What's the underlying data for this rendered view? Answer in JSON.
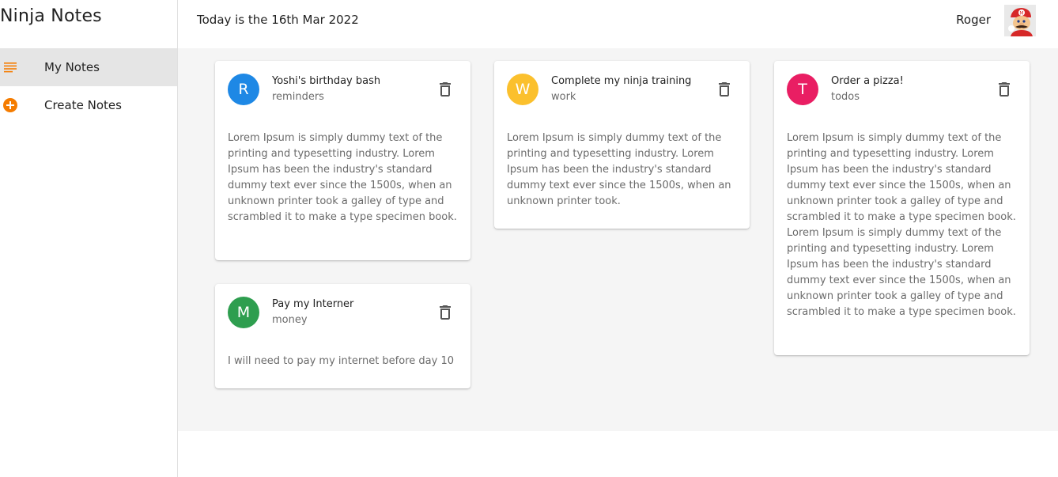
{
  "app": {
    "title": "Ninja Notes"
  },
  "sidebar": {
    "items": [
      {
        "label": "My Notes",
        "icon": "subject-icon",
        "active": true
      },
      {
        "label": "Create Notes",
        "icon": "add-circle-icon",
        "active": false
      }
    ]
  },
  "appbar": {
    "date_text": "Today is the 16th Mar 2022",
    "user_name": "Roger"
  },
  "colors": {
    "accent": "#f57c00",
    "avatar_reminders": "#1e88e5",
    "avatar_work": "#fbc02d",
    "avatar_todos": "#e91e63",
    "avatar_money": "#2e9e4f"
  },
  "notes": [
    {
      "initial": "R",
      "title": "Yoshi's birthday bash",
      "category": "reminders",
      "body": "Lorem Ipsum is simply dummy text of the printing and typesetting industry. Lorem Ipsum has been the industry's standard dummy text ever since the 1500s, when an unknown printer took a galley of type and scrambled it to make a type specimen book."
    },
    {
      "initial": "W",
      "title": "Complete my ninja training",
      "category": "work",
      "body": "Lorem Ipsum is simply dummy text of the printing and typesetting industry. Lorem Ipsum has been the industry's standard dummy text ever since the 1500s, when an unknown printer took."
    },
    {
      "initial": "T",
      "title": "Order a pizza!",
      "category": "todos",
      "body": "Lorem Ipsum is simply dummy text of the printing and typesetting industry. Lorem Ipsum has been the industry's standard dummy text ever since the 1500s, when an unknown printer took a galley of type and scrambled it to make a type specimen book. Lorem Ipsum is simply dummy text of the printing and typesetting industry. Lorem Ipsum has been the industry's standard dummy text ever since the 1500s, when an unknown printer took a galley of type and scrambled it to make a type specimen book."
    },
    {
      "initial": "M",
      "title": "Pay my Interner",
      "category": "money",
      "body": "I will need to pay my internet before day 10"
    }
  ]
}
